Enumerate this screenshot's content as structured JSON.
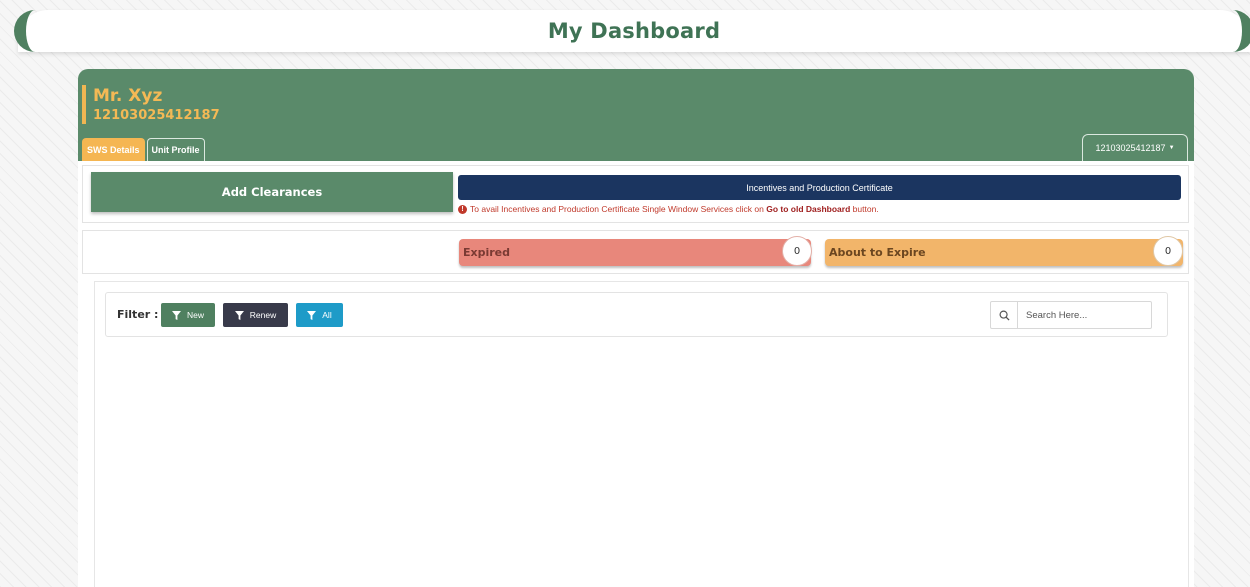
{
  "page": {
    "title": "My Dashboard"
  },
  "user": {
    "name": "Mr. Xyz",
    "id": "12103025412187"
  },
  "tabs": [
    {
      "label": "SWS Details",
      "active": true
    },
    {
      "label": "Unit Profile",
      "active": false
    }
  ],
  "unit_selector": {
    "value": "12103025412187"
  },
  "actions": {
    "add_clearances": "Add Clearances",
    "incentives": "Incentives and Production Certificate",
    "notice_prefix": "To avail Incentives and Production Certificate Single Window Services click on ",
    "notice_link": "Go to old Dashboard",
    "notice_suffix": " button."
  },
  "stats": {
    "expired": {
      "label": "Expired",
      "count": "0"
    },
    "about_to_expire": {
      "label": "About to Expire",
      "count": "0"
    }
  },
  "filter": {
    "label": "Filter :",
    "buttons": {
      "new": "New",
      "renew": "Renew",
      "all": "All"
    }
  },
  "search": {
    "placeholder": "Search Here..."
  },
  "colors": {
    "primary_green": "#5a8a6a",
    "accent_yellow": "#f5b652",
    "navy": "#1b3560",
    "expired": "#e8877b",
    "about_to_expire": "#f2b56a",
    "filter_all": "#1e9bc8",
    "filter_renew": "#383a4a"
  }
}
